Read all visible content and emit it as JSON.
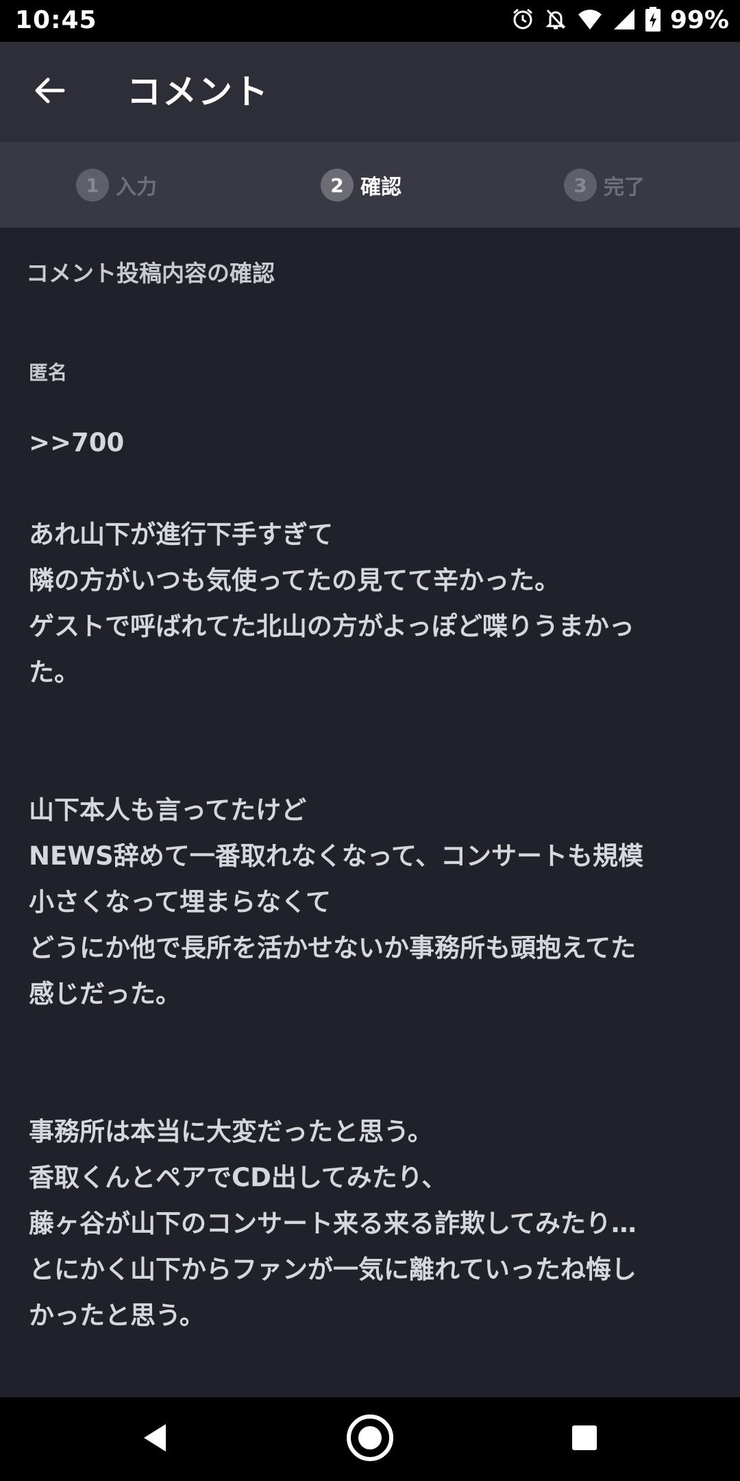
{
  "status_bar": {
    "time": "10:45",
    "battery_percent": "99%",
    "icons": [
      "alarm-icon",
      "notifications-off-icon",
      "wifi-icon",
      "signal-icon",
      "battery-charging-icon"
    ]
  },
  "app_bar": {
    "title": "コメント",
    "back_icon": "arrow-left-icon"
  },
  "steps": [
    {
      "number": "1",
      "label": "入力",
      "active": false
    },
    {
      "number": "2",
      "label": "確認",
      "active": true
    },
    {
      "number": "3",
      "label": "完了",
      "active": false
    }
  ],
  "content": {
    "section_title": "コメント投稿内容の確認",
    "author": "匿名",
    "comment_lines": [
      ">>700",
      "",
      "あれ山下が進行下手すぎて",
      "隣の方がいつも気使ってたの見てて辛かった。",
      "ゲストで呼ばれてた北山の方がよっぽど喋りうまかっ",
      "た。",
      "",
      "",
      "山下本人も言ってたけど",
      "NEWS辞めて一番取れなくなって、コンサートも規模",
      "小さくなって埋まらなくて",
      "どうにか他で長所を活かせないか事務所も頭抱えてた",
      "感じだった。",
      "",
      "",
      "事務所は本当に大変だったと思う。",
      "香取くんとペアでCD出してみたり、",
      "藤ヶ谷が山下のコンサート来る来る詐欺してみたり…",
      "とにかく山下からファンが一気に離れていったね悔し",
      "かったと思う。"
    ]
  },
  "nav_bar": {
    "icons": [
      "back-triangle-icon",
      "home-circle-icon",
      "recents-square-icon"
    ]
  },
  "colors": {
    "background": "#212229",
    "app_bar": "#2d2e36",
    "steps_bar": "#383942",
    "text": "#d6d7dc"
  }
}
